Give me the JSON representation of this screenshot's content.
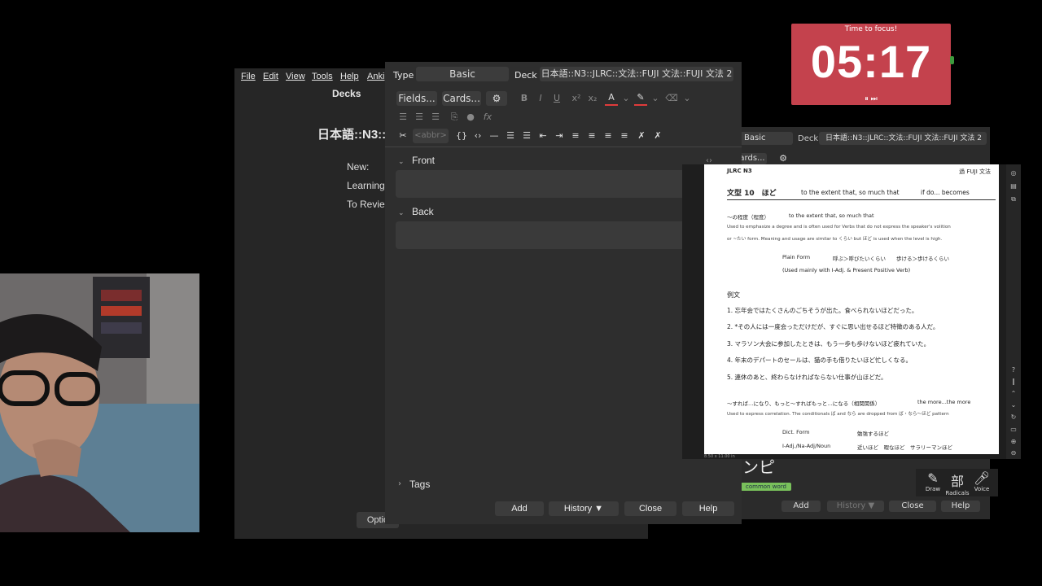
{
  "timer": {
    "label": "Time to focus!",
    "time": "05:17",
    "controls": "⏸ ⏭"
  },
  "main_window": {
    "menu": [
      "File",
      "Edit",
      "View",
      "Tools",
      "Help",
      "Anki"
    ],
    "title": "Decks",
    "deck_name": "日本語::N3::",
    "stats": [
      "New:",
      "Learning",
      "To Revie"
    ],
    "options_label": "Optio"
  },
  "editor": {
    "type_label": "Type",
    "type_value": "Basic",
    "deck_label": "Deck",
    "deck_value": "日本語::N3::JLRC::文法::FUJI 文法::FUJI 文法 2",
    "fields_btn": "Fields...",
    "cards_btn": "Cards...",
    "abbr_placeholder": "<abbr>",
    "front_label": "Front",
    "back_label": "Back",
    "tags_label": "Tags",
    "add_btn": "Add",
    "history_btn": "History ▼",
    "close_btn": "Close",
    "help_btn": "Help"
  },
  "editor2": {
    "type_value": "Basic",
    "deck_label": "Deck",
    "deck_value": "日本語::N3::JLRC::文法::FUJI 文法::FUJI 文法 2",
    "cards_btn": "ards...",
    "kana": "ンピ",
    "tag": "common word",
    "add_btn": "Add",
    "history_btn": "History ▼",
    "close_btn": "Close",
    "help_btn": "Help"
  },
  "pdf": {
    "header_left": "JLRC N3",
    "header_right": "過 FUJI 文法",
    "heading": "文型 10　ほど",
    "heading_en1": "to the extent that, so much that",
    "heading_en2": "if do... becomes",
    "sub1": "〜の程度（程度）",
    "sub1_en": "to the extent that, so much that",
    "para1a": "Used to emphasize a degree and is often used for Verbs that do not express the speaker's volition",
    "para1b": "or ~たい form. Meaning and usage are similar to くらい but ほど is used when the level is high.",
    "plain_label": "Plain Form",
    "plain_ex": "呼ぶ＞呼びたいくらい　　歩ける＞歩けるくらい",
    "plain_note": "(Used mainly with I-Adj. & Present Positive Verb)",
    "reibun": "例文",
    "ex1": "1. 忘年会ではたくさんのごちそうが出た。食べられないほどだった。",
    "ex2": "2. *その人には一度会っただけだが、すぐに思い出せるほど特徴のある人だ。",
    "ex3": "3. マラソン大会に参加したときは、もう一歩も歩けないほど疲れていた。",
    "ex4": "4. 年末のデパートのセールは、猫の手も借りたいほど忙しくなる。",
    "ex5": "5. 連休のあと、終わらなければならない仕事が山ほどだ。",
    "sub2": "〜すれば…になり、もっと〜すればもっと…になる（相関関係）",
    "sub2_en": "the more...the more",
    "para2": "Used to express correlation. The conditionals ば and なら are dropped from ば・なら〜ほど pattern",
    "dict_label": "Dict. Form",
    "dict_ex": "勉強するほど",
    "adj_label": "I-Adj./Na-Adj/Noun",
    "adj_ex": "近いほど　暇なほど　サラリーマンほど",
    "status": "8.50 x 11.00 in"
  },
  "handwriting": {
    "draw": "Draw",
    "radicals": "Radicals",
    "voice": "Voice",
    "radicals_char": "部"
  }
}
